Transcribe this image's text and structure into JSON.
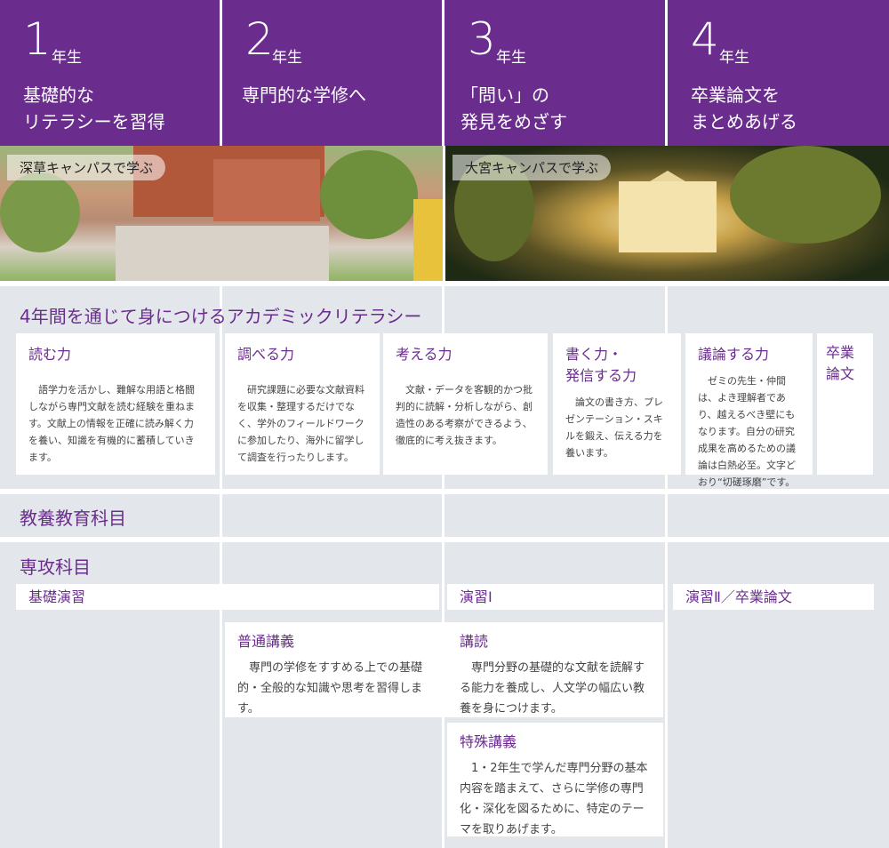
{
  "years": [
    {
      "num": "1",
      "unit": "年生",
      "tagline": "基礎的な\nリテラシーを習得"
    },
    {
      "num": "2",
      "unit": "年生",
      "tagline": "専門的な学修へ"
    },
    {
      "num": "3",
      "unit": "年生",
      "tagline": "「問い」の\n発見をめざす"
    },
    {
      "num": "4",
      "unit": "年生",
      "tagline": "卒業論文を\nまとめあげる"
    }
  ],
  "photos": {
    "left_caption": "深草キャンパスで学ぶ",
    "right_caption": "大宮キャンパスで学ぶ"
  },
  "literacy": {
    "title": "4年間を通じて身につけるアカデミックリテラシー",
    "cards": [
      {
        "title": "読む力",
        "body": "語学力を活かし、難解な用語と格闘しながら専門文献を読む経験を重ねます。文献上の情報を正確に読み解く力を養い、知識を有機的に蓄積していきます。"
      },
      {
        "title": "調べる力",
        "body": "研究課題に必要な文献資料を収集・整理するだけでなく、学外のフィールドワークに参加したり、海外に留学して調査を行ったりします。"
      },
      {
        "title": "考える力",
        "body": "文献・データを客観的かつ批判的に読解・分析しながら、創造性のある考察ができるよう、徹底的に考え抜きます。"
      },
      {
        "title": "書く力・\n発信する力",
        "body": "論文の書き方、プレゼンテーション・スキルを鍛え、伝える力を養います。"
      },
      {
        "title": "議論する力",
        "body": "ゼミの先生・仲間は、よき理解者であり、越えるべき壁にもなります。自分の研究成果を高めるための議論は白熱必至。文字どおり“切磋琢磨”です。"
      },
      {
        "title": "卒業\n論文",
        "body": ""
      }
    ]
  },
  "general": {
    "title": "教養教育科目"
  },
  "major": {
    "title": "専攻科目",
    "bars": [
      {
        "label": "基礎演習"
      },
      {
        "label": "演習Ⅰ"
      },
      {
        "label": "演習Ⅱ／卒業論文"
      }
    ],
    "courses": [
      {
        "title": "普通講義",
        "body": "専門の学修をすすめる上での基礎的・全般的な知識や思考を習得します。"
      },
      {
        "title": "講読",
        "body": "専門分野の基礎的な文献を読解する能力を養成し、人文学の幅広い教養を身につけます。"
      },
      {
        "title": "特殊講義",
        "body": "1・2年生で学んだ専門分野の基本内容を踏まえて、さらに学修の専門化・深化を図るために、特定のテーマを取りあげます。"
      }
    ]
  },
  "colors": {
    "purple": "#6a2c8d",
    "grid": "#e3e7ec"
  }
}
